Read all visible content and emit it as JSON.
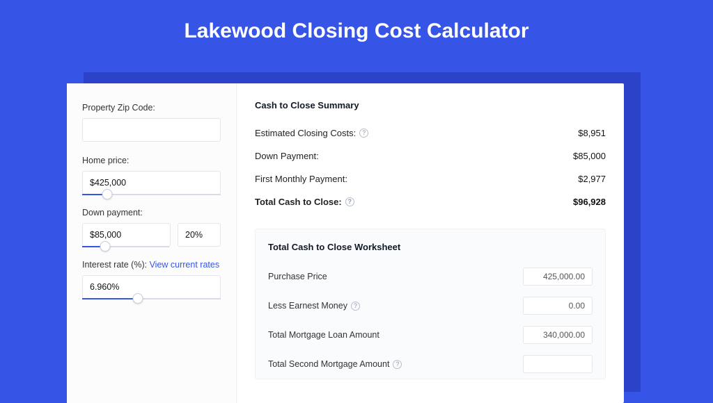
{
  "title": "Lakewood Closing Cost Calculator",
  "form": {
    "zip": {
      "label": "Property Zip Code:",
      "value": ""
    },
    "home_price": {
      "label": "Home price:",
      "value": "$425,000",
      "slider_pct": 18
    },
    "down_payment": {
      "label": "Down payment:",
      "value": "$85,000",
      "pct_value": "20%",
      "slider_pct": 26
    },
    "interest": {
      "label_prefix": "Interest rate (%): ",
      "link": "View current rates",
      "value": "6.960%",
      "slider_pct": 40
    }
  },
  "summary": {
    "title": "Cash to Close Summary",
    "rows": [
      {
        "label": "Estimated Closing Costs:",
        "help": true,
        "value": "$8,951",
        "bold": false
      },
      {
        "label": "Down Payment:",
        "help": false,
        "value": "$85,000",
        "bold": false
      },
      {
        "label": "First Monthly Payment:",
        "help": false,
        "value": "$2,977",
        "bold": false
      },
      {
        "label": "Total Cash to Close:",
        "help": true,
        "value": "$96,928",
        "bold": true
      }
    ]
  },
  "worksheet": {
    "title": "Total Cash to Close Worksheet",
    "rows": [
      {
        "label": "Purchase Price",
        "help": false,
        "value": "425,000.00"
      },
      {
        "label": "Less Earnest Money",
        "help": true,
        "value": "0.00"
      },
      {
        "label": "Total Mortgage Loan Amount",
        "help": false,
        "value": "340,000.00"
      },
      {
        "label": "Total Second Mortgage Amount",
        "help": true,
        "value": ""
      }
    ]
  }
}
